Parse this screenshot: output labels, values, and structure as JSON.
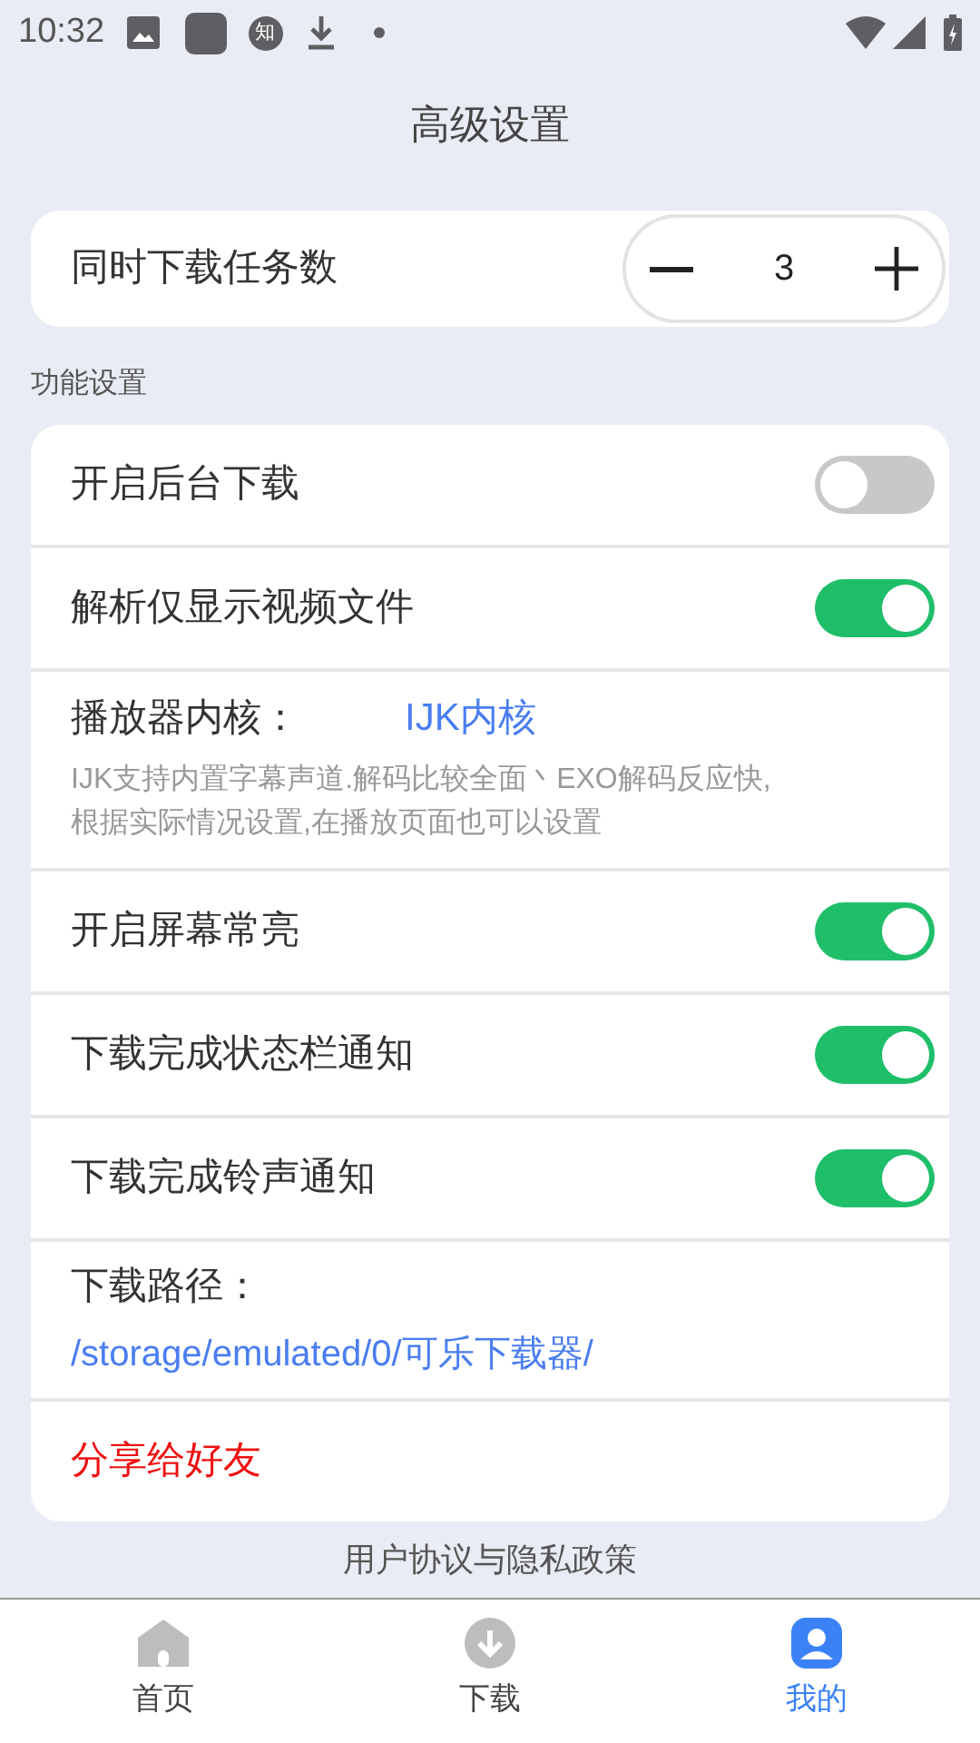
{
  "status_bar": {
    "time": "10:32",
    "badge": "知"
  },
  "title": "高级设置",
  "concurrent": {
    "label": "同时下载任务数",
    "value": "3"
  },
  "section": "功能设置",
  "rows": [
    {
      "kind": "toggle",
      "label": "开启后台下载",
      "on": false
    },
    {
      "kind": "toggle",
      "label": "解析仅显示视频文件",
      "on": true
    },
    {
      "kind": "choice",
      "label": "播放器内核：",
      "value": "IJK内核",
      "description": "IJK支持内置字幕声道.解码比较全面丶EXO解码反应快,根据实际情况设置,在播放页面也可以设置"
    },
    {
      "kind": "toggle",
      "label": "开启屏幕常亮",
      "on": true
    },
    {
      "kind": "toggle",
      "label": "下载完成状态栏通知",
      "on": true
    },
    {
      "kind": "toggle",
      "label": "下载完成铃声通知",
      "on": true
    },
    {
      "kind": "path",
      "label": "下载路径：",
      "value": "/storage/emulated/0/可乐下载器/"
    },
    {
      "kind": "action",
      "label": "分享给好友"
    }
  ],
  "footer_link": "用户协议与隐私政策",
  "nav": [
    {
      "kind": "home",
      "label": "首页",
      "selected": false
    },
    {
      "kind": "download",
      "label": "下载",
      "selected": false
    },
    {
      "kind": "profile",
      "label": "我的",
      "selected": true
    }
  ]
}
